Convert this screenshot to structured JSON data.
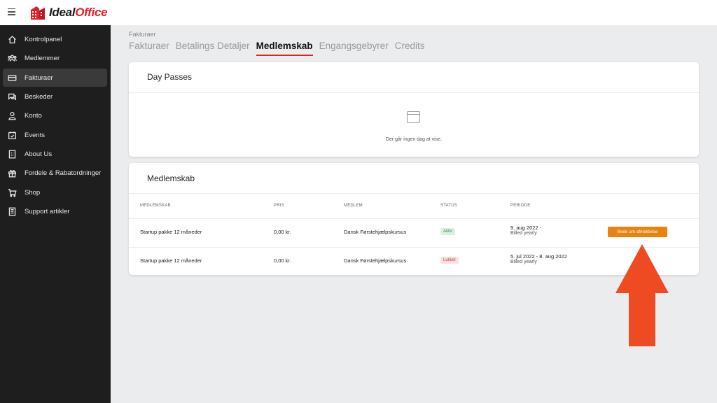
{
  "app": {
    "logo_brand": "IdealOffice",
    "logo_part1": "Ideal",
    "logo_part2": "Office"
  },
  "sidebar": {
    "items": [
      {
        "label": "Kontrolpanel",
        "icon": "home-icon"
      },
      {
        "label": "Medlemmer",
        "icon": "users-icon"
      },
      {
        "label": "Fakturaer",
        "icon": "card-icon",
        "active": true
      },
      {
        "label": "Beskeder",
        "icon": "chat-icon"
      },
      {
        "label": "Konto",
        "icon": "user-icon"
      },
      {
        "label": "Events",
        "icon": "calendar-icon"
      },
      {
        "label": "About Us",
        "icon": "building-icon"
      },
      {
        "label": "Fordele & Rabatordninger",
        "icon": "gift-icon"
      },
      {
        "label": "Shop",
        "icon": "cart-icon"
      },
      {
        "label": "Support artikler",
        "icon": "document-icon"
      }
    ]
  },
  "header": {
    "breadcrumb": "Fakturaer",
    "tabs": [
      {
        "label": "Fakturaer"
      },
      {
        "label": "Betalings Detaljer"
      },
      {
        "label": "Medlemskab",
        "active": true
      },
      {
        "label": "Engangsgebyrer"
      },
      {
        "label": "Credits"
      }
    ]
  },
  "day_passes": {
    "title": "Day Passes",
    "empty_text": "Der går ingen dag at vise."
  },
  "membership": {
    "title": "Medlemskab",
    "columns": [
      "MEDLEMSKAB",
      "PRIS",
      "MEDLEM",
      "STATUS",
      "PERIODE"
    ],
    "rows": [
      {
        "membership": "Startup pakke 12 måneder",
        "price": "0,00 kr.",
        "member": "Dansk Førstehjælpskursus",
        "status": "Aktiv",
        "period": "9. aug 2022 -",
        "billing": "Billed yearly",
        "action": "Bede om afmeldelse"
      },
      {
        "membership": "Startup pakke 12 måneder",
        "price": "0,00 kr.",
        "member": "Dansk Førstehjælpskursus",
        "status": "Lukket",
        "period": "5. jul 2022 - 8. aug 2022",
        "billing": "Billed yearly"
      }
    ]
  },
  "colors": {
    "accent": "#e02127",
    "action_button": "#e8830e",
    "annotation_arrow": "#ee4b22",
    "sidebar_bg": "#1e1e1e",
    "status_active": "#3c8a5a",
    "status_closed": "#d0404a"
  }
}
